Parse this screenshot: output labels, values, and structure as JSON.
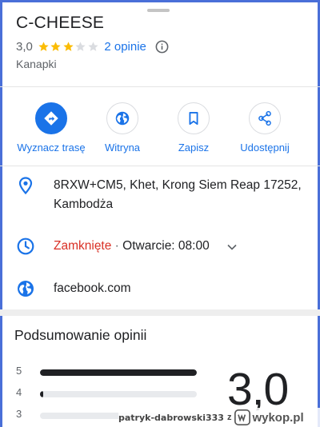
{
  "place": {
    "title": "C-CHEESE",
    "rating": "3,0",
    "stars_filled": 3,
    "stars_total": 5,
    "reviews_link": "2 opinie",
    "category": "Kanapki"
  },
  "actions": [
    {
      "label": "Wyznacz trasę",
      "icon": "directions-icon",
      "primary": true
    },
    {
      "label": "Witryna",
      "icon": "globe-icon",
      "primary": false
    },
    {
      "label": "Zapisz",
      "icon": "bookmark-icon",
      "primary": false
    },
    {
      "label": "Udostępnij",
      "icon": "share-icon",
      "primary": false
    }
  ],
  "details": {
    "address_line1": "8RXW+CM5, Khet, Krong Siem Reap 17252,",
    "address_line2": "Kambodża",
    "hours_status": "Zamknięte",
    "hours_separator": " · ",
    "hours_open": "Otwarcie: 08:00",
    "website": "facebook.com"
  },
  "summary": {
    "title": "Podsumowanie opinii",
    "big_rating": "3,0",
    "bars": [
      {
        "label": "5",
        "fraction": 1.0
      },
      {
        "label": "4",
        "fraction": 0.02
      },
      {
        "label": "3",
        "fraction": 0.0
      }
    ]
  },
  "watermark": {
    "user": "patryk-dabrowski333",
    "z": "z",
    "site": "wykop.pl"
  },
  "colors": {
    "accent": "#1a73e8",
    "closed": "#d93025",
    "star": "#fbbc04",
    "star_empty": "#dadce0",
    "frame": "#4a6fd8"
  }
}
